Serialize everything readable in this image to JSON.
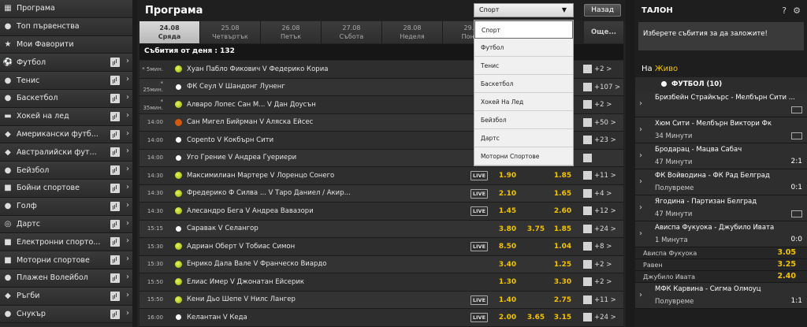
{
  "sidebar": [
    {
      "label": "Програма",
      "icon": "calendar-icon",
      "glyph": "▦",
      "stats": false
    },
    {
      "label": "Топ първенства",
      "icon": "medal-icon",
      "glyph": "●",
      "stats": false
    },
    {
      "label": "Мои Фаворити",
      "icon": "star-icon",
      "glyph": "★",
      "stats": false
    },
    {
      "label": "Футбол",
      "icon": "football-icon",
      "glyph": "⚽",
      "stats": true
    },
    {
      "label": "Тенис",
      "icon": "tennis-icon",
      "glyph": "●",
      "stats": true
    },
    {
      "label": "Баскетбол",
      "icon": "basketball-icon",
      "glyph": "●",
      "stats": true
    },
    {
      "label": "Хокей на лед",
      "icon": "hockey-icon",
      "glyph": "▬",
      "stats": true
    },
    {
      "label": "Американски футб...",
      "icon": "american-football-icon",
      "glyph": "◆",
      "stats": true
    },
    {
      "label": "Австралийски фут...",
      "icon": "aussie-rules-icon",
      "glyph": "◆",
      "stats": true
    },
    {
      "label": "Бейзбол",
      "icon": "baseball-icon",
      "glyph": "●",
      "stats": true
    },
    {
      "label": "Бойни спортове",
      "icon": "boxing-icon",
      "glyph": "■",
      "stats": true
    },
    {
      "label": "Голф",
      "icon": "golf-icon",
      "glyph": "●",
      "stats": true
    },
    {
      "label": "Дартс",
      "icon": "darts-icon",
      "glyph": "◎",
      "stats": true
    },
    {
      "label": "Електронни спорто...",
      "icon": "esports-icon",
      "glyph": "■",
      "stats": true
    },
    {
      "label": "Моторни спортове",
      "icon": "motorsport-icon",
      "glyph": "■",
      "stats": true
    },
    {
      "label": "Плажен Волейбол",
      "icon": "beach-volleyball-icon",
      "glyph": "●",
      "stats": true
    },
    {
      "label": "Ръгби",
      "icon": "rugby-icon",
      "glyph": "◆",
      "stats": true
    },
    {
      "label": "Снукър",
      "icon": "snooker-icon",
      "glyph": "●",
      "stats": true
    }
  ],
  "header": {
    "title": "Програма",
    "back": "Назад",
    "select_value": "Спорт"
  },
  "dates": [
    {
      "date": "24.08",
      "day": "Сряда",
      "active": true
    },
    {
      "date": "25.08",
      "day": "Четвъртък",
      "active": false
    },
    {
      "date": "26.08",
      "day": "Петък",
      "active": false
    },
    {
      "date": "27.08",
      "day": "Събота",
      "active": false
    },
    {
      "date": "28.08",
      "day": "Неделя",
      "active": false
    },
    {
      "date": "29.08",
      "day": "Поне...",
      "active": false
    }
  ],
  "dates_more": "Още...",
  "count_label": "Събития от деня : 132",
  "dropdown": [
    "Спорт",
    "Футбол",
    "Тенис",
    "Баскетбол",
    "Хокей На Лед",
    "Бейзбол",
    "Дартс",
    "Моторни Спортове"
  ],
  "events": [
    {
      "time": "* 5мин.",
      "sport": "tennis",
      "name": "Хуан Пабло Фикович V Федерико Кориа",
      "live": false,
      "o1": "",
      "o2": "",
      "o3": "0",
      "more": "+2 >"
    },
    {
      "time": "* 25мин.",
      "sport": "football",
      "name": "ФК Сеул V Шандонг Луненг",
      "live": false,
      "o1": "",
      "o2": "",
      "o3": "0",
      "more": "+107 >"
    },
    {
      "time": "* 35мин.",
      "sport": "tennis",
      "name": "Алваро Лопес Сан М... V Дан Доусън",
      "live": false,
      "o1": "",
      "o2": "",
      "o3": "0",
      "more": "+2 >"
    },
    {
      "time": "14:00",
      "sport": "basketball",
      "name": "Сан Мигел Бийрман V Аляска Ейсес",
      "live": false,
      "o1": "",
      "o2": "",
      "o3": "0",
      "more": "+50 >"
    },
    {
      "time": "14:00",
      "sport": "football",
      "name": "Сорento V Кокбърн Сити",
      "live": false,
      "o1": "",
      "o2": "",
      "o3": "0",
      "more": "+23 >"
    },
    {
      "time": "14:00",
      "sport": "football",
      "name": "Уго Грение V Андреа Гуериери",
      "live": false,
      "o1": "",
      "o2": "",
      "o3": "0",
      "more": ""
    },
    {
      "time": "14:30",
      "sport": "tennis",
      "name": "Максимилиан Мартере V Лоренцо Сонего",
      "live": true,
      "o1": "1.90",
      "o2": "",
      "o3": "1.85",
      "more": "+11 >"
    },
    {
      "time": "14:30",
      "sport": "tennis",
      "name": "Фредерико Ф Силва ... V Таро Даниел / Акир...",
      "live": true,
      "o1": "2.10",
      "o2": "",
      "o3": "1.65",
      "more": "+4 >"
    },
    {
      "time": "14:30",
      "sport": "tennis",
      "name": "Алесандро Бега V Андреа Вавазори",
      "live": true,
      "o1": "1.45",
      "o2": "",
      "o3": "2.60",
      "more": "+12 >"
    },
    {
      "time": "15:15",
      "sport": "football",
      "name": "Саравак V Селангор",
      "live": false,
      "o1": "3.80",
      "o2": "3.75",
      "o3": "1.85",
      "more": "+24 >"
    },
    {
      "time": "15:30",
      "sport": "tennis",
      "name": "Адриан Оберт V Тобиас Симон",
      "live": true,
      "o1": "8.50",
      "o2": "",
      "o3": "1.04",
      "more": "+8 >"
    },
    {
      "time": "15:30",
      "sport": "tennis",
      "name": "Енрико Дала Вале V Франческо Виардо",
      "live": false,
      "o1": "3.40",
      "o2": "",
      "o3": "1.25",
      "more": "+2 >"
    },
    {
      "time": "15:50",
      "sport": "tennis",
      "name": "Елиас Имер V Джонатан Ейсерик",
      "live": false,
      "o1": "1.30",
      "o2": "",
      "o3": "3.30",
      "more": "+2 >"
    },
    {
      "time": "15:50",
      "sport": "tennis",
      "name": "Кени Дьо Шепе V Нилс Лангер",
      "live": true,
      "o1": "1.40",
      "o2": "",
      "o3": "2.75",
      "more": "+11 >"
    },
    {
      "time": "16:00",
      "sport": "football",
      "name": "Келантан V Кеда",
      "live": true,
      "o1": "2.00",
      "o2": "3.65",
      "o3": "3.15",
      "more": "+24 >"
    }
  ],
  "slip": {
    "title": "ТАЛОН",
    "message": "Изберете събития за да заложите!"
  },
  "live": {
    "prefix": "На ",
    "highlight": "Живо",
    "sport": "ФУТБОЛ (10)"
  },
  "live_events": [
    {
      "name": "Бризбейн Страйкърс - Мелбърн Сити ...",
      "sub": "",
      "tv": true,
      "score": ""
    },
    {
      "name": "Хюм Сити - Мелбърн Виктори Фк",
      "sub": "34 Минути",
      "tv": true,
      "score": ""
    },
    {
      "name": "Бродарац - Мацва Сабач",
      "sub": "47 Минути",
      "tv": false,
      "score": "2:1"
    },
    {
      "name": "ФК Войводина - ФК Рад Белград",
      "sub": "Полувреме",
      "tv": false,
      "score": "0:1"
    },
    {
      "name": "Ягодина - Партизан Белград",
      "sub": "47 Минути",
      "tv": true,
      "score": ""
    },
    {
      "name": "Ависпа Фукуока - Джубило Ивата",
      "sub": "1 Минута",
      "tv": false,
      "score": "0:0"
    }
  ],
  "live_odds": [
    {
      "label": "Ависпа Фукуока",
      "value": "3.05"
    },
    {
      "label": "Равен",
      "value": "3.25"
    },
    {
      "label": "Джубило Ивата",
      "value": "2.40"
    }
  ],
  "live_tail": {
    "name": "МФК Карвина - Сигма Олмоуц",
    "sub": "Полувреме",
    "score": "1:1"
  }
}
